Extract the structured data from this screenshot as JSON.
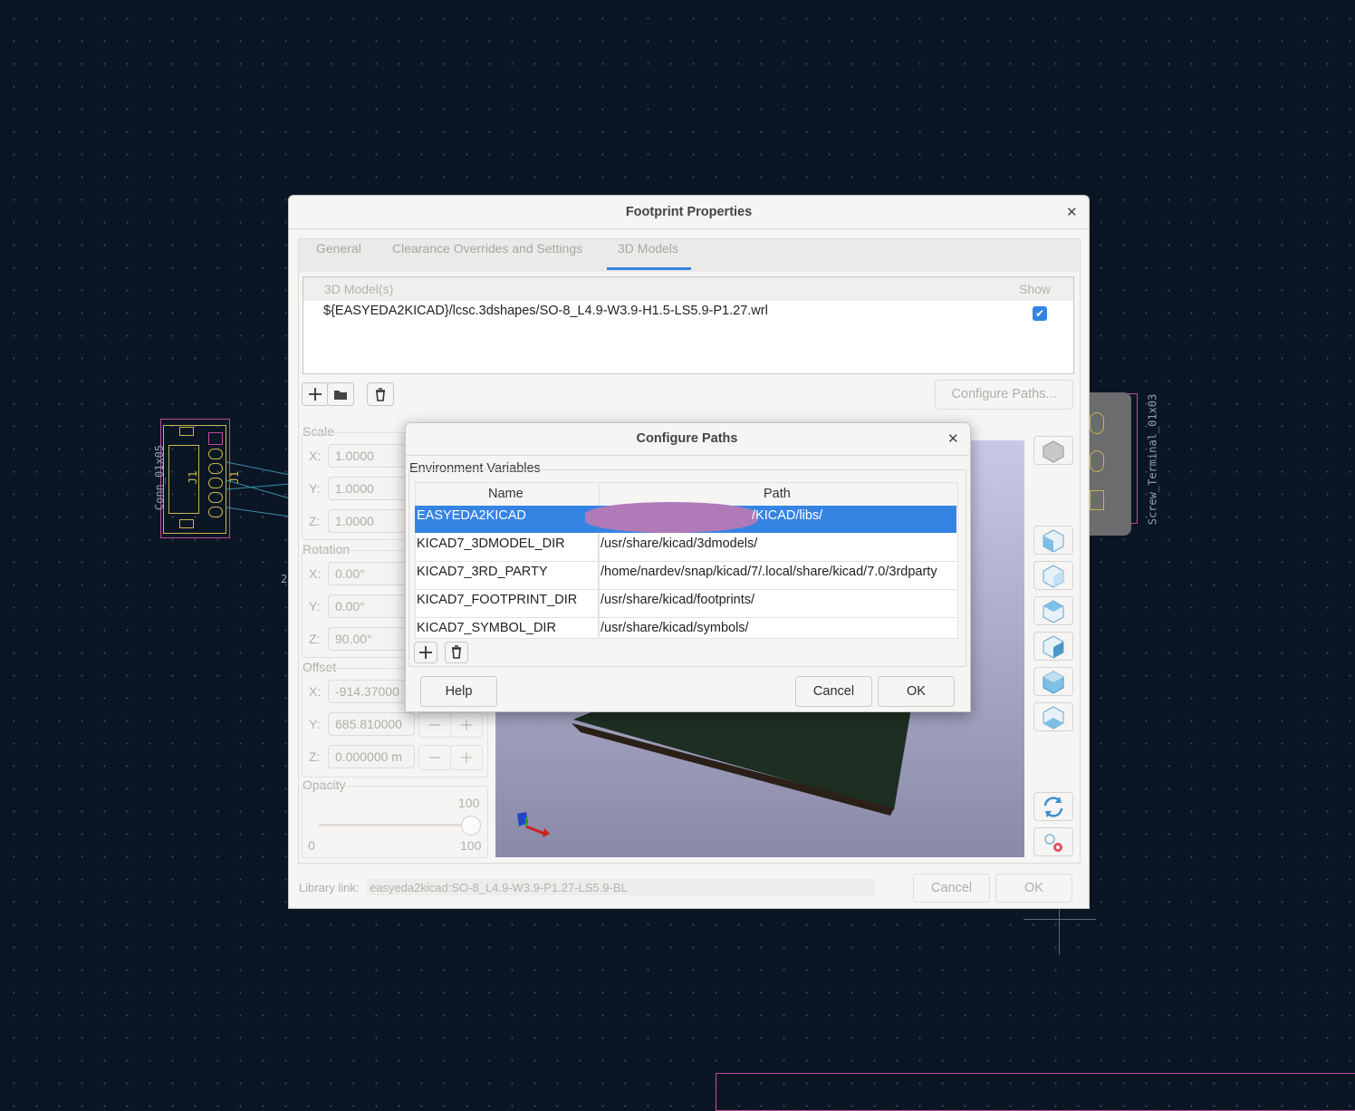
{
  "pcb": {
    "left_ref": "Conn_01x05",
    "left_label_1": "J1",
    "left_label_2": "J1",
    "right_ref": "Screw_Terminal_01x03",
    "stray_mark": "2"
  },
  "footprint_dialog": {
    "title": "Footprint Properties",
    "tabs": [
      "General",
      "Clearance Overrides and Settings",
      "3D Models"
    ],
    "active_tab": "3D Models",
    "models_table": {
      "col_model": "3D Model(s)",
      "col_show": "Show",
      "rows": [
        {
          "path": "${EASYEDA2KICAD}/lcsc.3dshapes/SO-8_L4.9-W3.9-H1.5-LS5.9-P1.27.wrl",
          "show": true
        }
      ]
    },
    "configure_paths_label": "Configure Paths...",
    "scale": {
      "group_label": "Scale",
      "x_label": "X:",
      "x": "1.0000",
      "y_label": "Y:",
      "y": "1.0000",
      "z_label": "Z:",
      "z": "1.0000"
    },
    "rotation": {
      "group_label": "Rotation",
      "x_label": "X:",
      "x": "0.00°",
      "y_label": "Y:",
      "y": "0.00°",
      "z_label": "Z:",
      "z": "90.00°"
    },
    "offset": {
      "group_label": "Offset",
      "x_label": "X:",
      "x": "-914.37000",
      "y_label": "Y:",
      "y": "685.810000",
      "z_label": "Z:",
      "z": "0.000000 m"
    },
    "opacity": {
      "group_label": "Opacity",
      "max_top": "100",
      "min": "0",
      "max": "100",
      "value": 100
    },
    "library_link_label": "Library link:",
    "library_link_value": "easyeda2kicad:SO-8_L4.9-W3.9-P1.27-LS5.9-BL",
    "cancel_label": "Cancel",
    "ok_label": "OK"
  },
  "configure_paths_dialog": {
    "title": "Configure Paths",
    "group_label": "Environment Variables",
    "col_name": "Name",
    "col_path": "Path",
    "rows": [
      {
        "name": "EASYEDA2KICAD",
        "path": "/KICAD/libs/",
        "selected": true
      },
      {
        "name": "KICAD7_3DMODEL_DIR",
        "path": "/usr/share/kicad/3dmodels/"
      },
      {
        "name": "KICAD7_3RD_PARTY",
        "path": "/home/nardev/snap/kicad/7/.local/share/kicad/7.0/3rdparty"
      },
      {
        "name": "KICAD7_FOOTPRINT_DIR",
        "path": "/usr/share/kicad/footprints/"
      },
      {
        "name": "KICAD7_SYMBOL_DIR",
        "path": "/usr/share/kicad/symbols/"
      }
    ],
    "help_label": "Help",
    "cancel_label": "Cancel",
    "ok_label": "OK"
  },
  "colors": {
    "canvas_bg": "#0b1624",
    "selection": "#3584e4",
    "footprint_outline": "#c04a9c",
    "silkscreen": "#c8b64a",
    "redaction": "#b07ab8"
  }
}
